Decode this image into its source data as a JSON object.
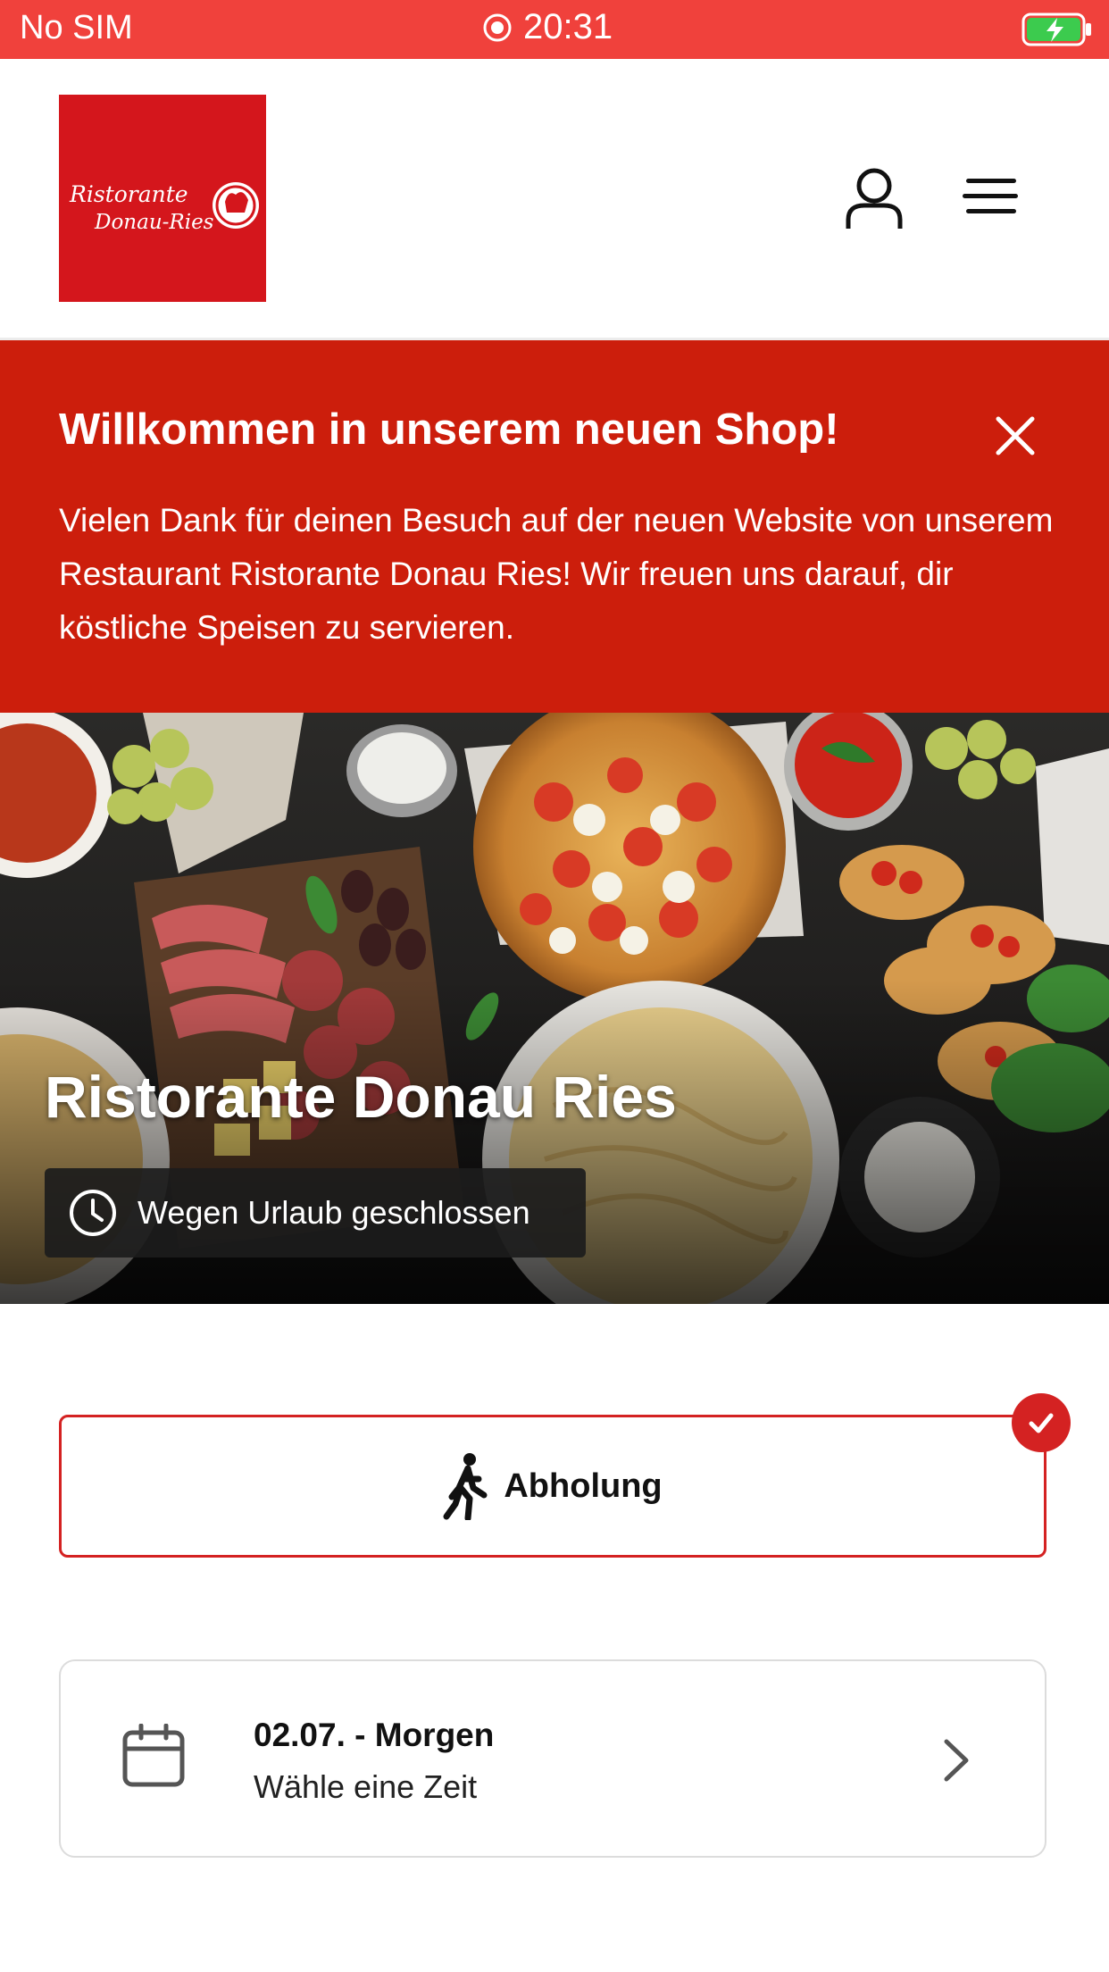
{
  "status_bar": {
    "carrier": "No SIM",
    "time": "20:31",
    "icons": [
      "location-icon",
      "battery-charging-icon"
    ]
  },
  "header": {
    "logo": {
      "text_line1": "Ristorante",
      "text_line2": "Donau-Ries",
      "color": "#d4161c"
    },
    "icons": [
      "user-icon",
      "menu-icon"
    ]
  },
  "banner": {
    "title": "Willkommen in unserem neuen Shop!",
    "text": "Vielen Dank für deinen Besuch auf der neuen Website von unserem Restaurant Ristorante Donau Ries! Wir freuen uns darauf, dir köstliche Speisen zu servieren.",
    "color": "#cc1e0c"
  },
  "hero": {
    "restaurant_name": "Ristorante Donau Ries",
    "status": "Wegen Urlaub geschlossen"
  },
  "order_type": {
    "label": "Abholung",
    "selected": true,
    "accent": "#d42222"
  },
  "schedule": {
    "date_label": "02.07. - Morgen",
    "time_prompt": "Wähle eine Zeit"
  }
}
